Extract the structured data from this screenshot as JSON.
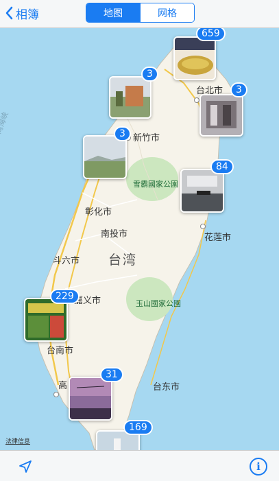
{
  "nav": {
    "back_label": "相簿",
    "tabs": [
      "地图",
      "网格"
    ]
  },
  "map": {
    "labels": {
      "taipei": "台北市",
      "hsinchu": "新竹市",
      "xueba": "雪霸國家公園",
      "changhua": "彰化市",
      "nantou": "南投市",
      "taiwan": "台湾",
      "hualien": "花莲市",
      "douliu": "斗六市",
      "chiayi": "嘉义市",
      "yushan": "玉山國家公園",
      "tainan": "台南市",
      "kaohsiung": "高",
      "taitung": "台东市",
      "strait": "湾海峡"
    },
    "clusters": [
      {
        "count": "659",
        "name": "taipei-north"
      },
      {
        "count": "3",
        "name": "taoyuan"
      },
      {
        "count": "3",
        "name": "keelung"
      },
      {
        "count": "3",
        "name": "hsinchu"
      },
      {
        "count": "84",
        "name": "hualien"
      },
      {
        "count": "229",
        "name": "tainan"
      },
      {
        "count": "31",
        "name": "kaohsiung"
      },
      {
        "count": "169",
        "name": "south"
      }
    ],
    "legal": "法律信息"
  },
  "colors": {
    "accent": "#1a7cf2",
    "land": "#f6f3ea",
    "sea": "#a6d8f1",
    "park": "#cce7bf"
  }
}
